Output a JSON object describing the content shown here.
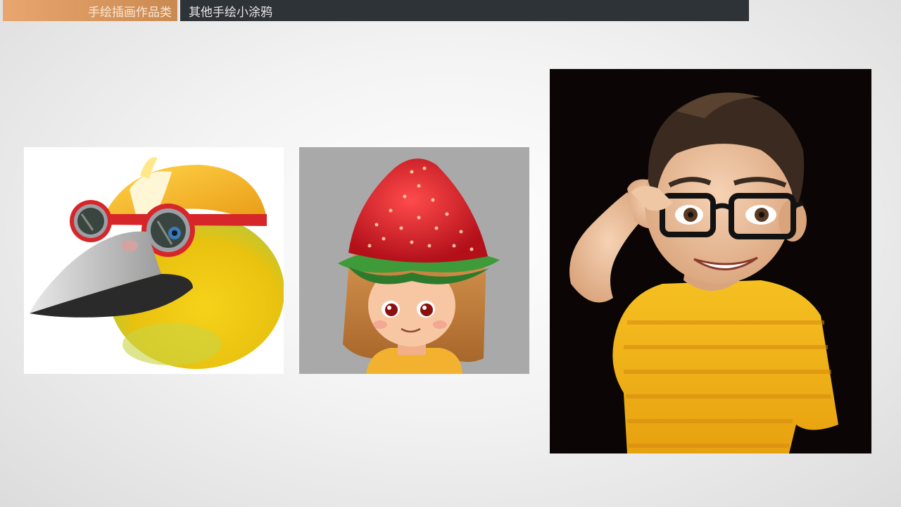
{
  "header": {
    "category_label": "手绘插画作品类",
    "section_title": "其他手绘小涂鸦"
  },
  "gallery": {
    "items": [
      {
        "icon": "yellow-bird-with-goggles-illustration"
      },
      {
        "icon": "strawberry-hat-girl-illustration"
      },
      {
        "icon": "boy-with-glasses-illustration"
      }
    ]
  },
  "colors": {
    "accent": "#d9955c",
    "header_bar": "#2e3338"
  }
}
